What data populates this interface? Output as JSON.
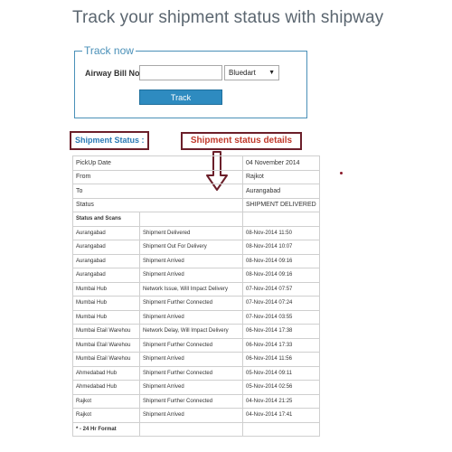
{
  "page_title": "Track your shipment status with shipway",
  "track_form": {
    "legend": "Track now",
    "awb_label": "Airway Bill No:",
    "awb_value": "",
    "courier_selected": "Bluedart",
    "track_button": "Track"
  },
  "annotations": {
    "shipment_status_label": "Shipment Status :",
    "details_label": "Shipment status details",
    "accent_color": "#6b1f2a"
  },
  "summary": [
    {
      "label": "PickUp Date",
      "value": "04 November 2014"
    },
    {
      "label": "From",
      "value": "Rajkot"
    },
    {
      "label": "To",
      "value": "Aurangabad"
    },
    {
      "label": "Status",
      "value": "SHIPMENT DELIVERED"
    }
  ],
  "scans_header": "Status and Scans",
  "scans": [
    {
      "location": "Aurangabad",
      "status": "Shipment Delivered",
      "datetime": "08-Nov-2014 11:50"
    },
    {
      "location": "Aurangabad",
      "status": "Shipment Out For Delivery",
      "datetime": "08-Nov-2014 10:07"
    },
    {
      "location": "Aurangabad",
      "status": "Shipment Arrived",
      "datetime": "08-Nov-2014 09:16"
    },
    {
      "location": "Aurangabad",
      "status": "Shipment Arrived",
      "datetime": "08-Nov-2014 09:16"
    },
    {
      "location": "Mumbai Hub",
      "status": "Network Issue, Will Impact Delivery",
      "datetime": "07-Nov-2014 07:57"
    },
    {
      "location": "Mumbai Hub",
      "status": "Shipment Further Connected",
      "datetime": "07-Nov-2014 07:24"
    },
    {
      "location": "Mumbai Hub",
      "status": "Shipment Arrived",
      "datetime": "07-Nov-2014 03:55"
    },
    {
      "location": "Mumbai Etail Warehou",
      "status": "Network Delay, Will Impact Delivery",
      "datetime": "06-Nov-2014 17:38"
    },
    {
      "location": "Mumbai Etail Warehou",
      "status": "Shipment Further Connected",
      "datetime": "06-Nov-2014 17:33"
    },
    {
      "location": "Mumbai Etail Warehou",
      "status": "Shipment Arrived",
      "datetime": "06-Nov-2014 11:56"
    },
    {
      "location": "Ahmedabad Hub",
      "status": "Shipment Further Connected",
      "datetime": "05-Nov-2014 09:11"
    },
    {
      "location": "Ahmedabad Hub",
      "status": "Shipment Arrived",
      "datetime": "05-Nov-2014 02:56"
    },
    {
      "location": "Rajkot",
      "status": "Shipment Further Connected",
      "datetime": "04-Nov-2014 21:25"
    },
    {
      "location": "Rajkot",
      "status": "Shipment Arrived",
      "datetime": "04-Nov-2014 17:41"
    }
  ],
  "footer_note": "* - 24 Hr Format"
}
